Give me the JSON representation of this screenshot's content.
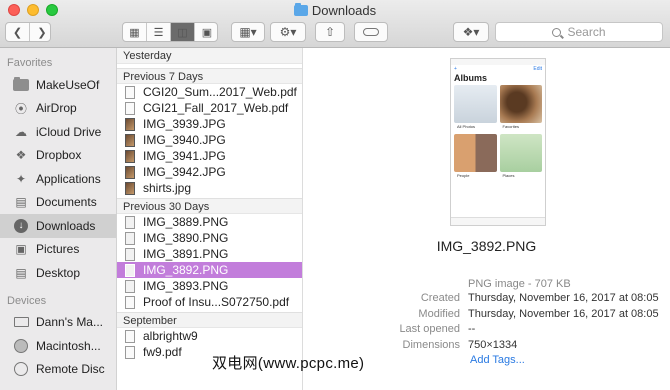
{
  "window": {
    "title": "Downloads"
  },
  "toolbar": {
    "back_icon": "chevron-left-icon",
    "forward_icon": "chevron-right-icon",
    "search_placeholder": "Search"
  },
  "sidebar": {
    "favorites_header": "Favorites",
    "favorites": [
      {
        "label": "MakeUseOf",
        "icon": "folder-icon"
      },
      {
        "label": "AirDrop",
        "icon": "airdrop-icon"
      },
      {
        "label": "iCloud Drive",
        "icon": "cloud-icon"
      },
      {
        "label": "Dropbox",
        "icon": "dropbox-icon"
      },
      {
        "label": "Applications",
        "icon": "applications-icon"
      },
      {
        "label": "Documents",
        "icon": "documents-icon"
      },
      {
        "label": "Downloads",
        "icon": "downloads-icon",
        "selected": true
      },
      {
        "label": "Pictures",
        "icon": "pictures-icon"
      },
      {
        "label": "Desktop",
        "icon": "desktop-icon"
      }
    ],
    "devices_header": "Devices",
    "devices": [
      {
        "label": "Dann's Ma...",
        "icon": "laptop-icon"
      },
      {
        "label": "Macintosh...",
        "icon": "disk-icon"
      },
      {
        "label": "Remote Disc",
        "icon": "disc-icon"
      }
    ]
  },
  "column": {
    "groups": [
      {
        "label": "Yesterday",
        "files": []
      },
      {
        "label": "Previous 7 Days",
        "files": [
          {
            "name": "CGI20_Sum...2017_Web.pdf",
            "type": "pdf"
          },
          {
            "name": "CGI21_Fall_2017_Web.pdf",
            "type": "pdf"
          },
          {
            "name": "IMG_3939.JPG",
            "type": "img"
          },
          {
            "name": "IMG_3940.JPG",
            "type": "img"
          },
          {
            "name": "IMG_3941.JPG",
            "type": "img"
          },
          {
            "name": "IMG_3942.JPG",
            "type": "img"
          },
          {
            "name": "shirts.jpg",
            "type": "img"
          }
        ]
      },
      {
        "label": "Previous 30 Days",
        "files": [
          {
            "name": "IMG_3889.PNG",
            "type": "png"
          },
          {
            "name": "IMG_3890.PNG",
            "type": "png"
          },
          {
            "name": "IMG_3891.PNG",
            "type": "png"
          },
          {
            "name": "IMG_3892.PNG",
            "type": "png",
            "selected": true
          },
          {
            "name": "IMG_3893.PNG",
            "type": "png"
          },
          {
            "name": "Proof of Insu...S072750.pdf",
            "type": "pdf"
          }
        ]
      },
      {
        "label": "September",
        "files": [
          {
            "name": "albrightw9",
            "type": "pdf"
          },
          {
            "name": "fw9.pdf",
            "type": "pdf"
          }
        ]
      }
    ]
  },
  "preview": {
    "thumbnail": {
      "title": "Albums",
      "nav_left": "+",
      "nav_right": "Edit",
      "album_captions": [
        "All Photos",
        "Favorites",
        "People",
        "Places"
      ]
    },
    "file_name": "IMG_3892.PNG",
    "kind": "PNG image - 707 KB",
    "meta": [
      {
        "label": "Created",
        "value": "Thursday, November 16, 2017 at 08:05"
      },
      {
        "label": "Modified",
        "value": "Thursday, November 16, 2017 at 08:05"
      },
      {
        "label": "Last opened",
        "value": "--"
      },
      {
        "label": "Dimensions",
        "value": "750×1334"
      }
    ],
    "add_tags": "Add Tags..."
  },
  "watermark": "双电网(www.pcpc.me)"
}
